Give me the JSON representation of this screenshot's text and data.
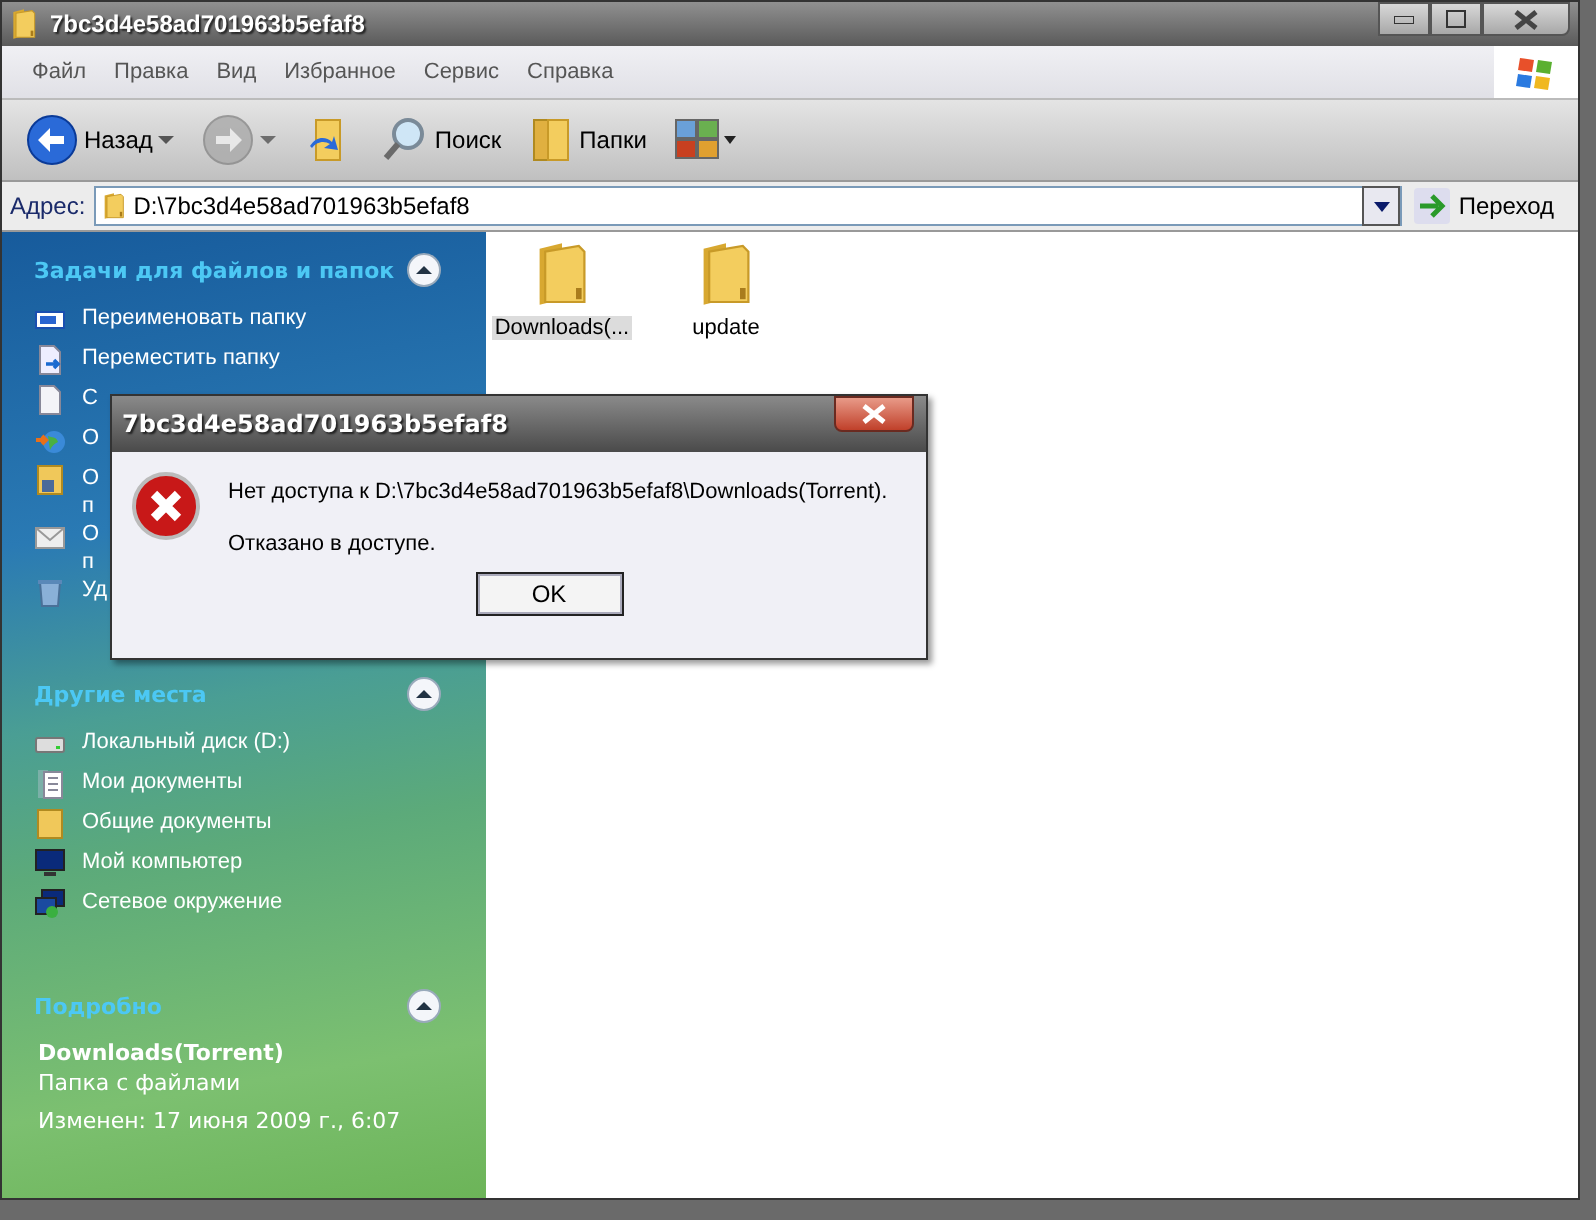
{
  "window": {
    "title": "7bc3d4e58ad701963b5efaf8"
  },
  "menu": [
    "Файл",
    "Правка",
    "Вид",
    "Избранное",
    "Сервис",
    "Справка"
  ],
  "toolbar": [
    {
      "kind": "back",
      "label": "Назад",
      "disabled": false
    },
    {
      "kind": "forward",
      "disabled": true
    },
    {
      "kind": "up",
      "disabled": false
    },
    {
      "kind": "search",
      "label": "Поиск",
      "disabled": false
    },
    {
      "kind": "folders",
      "label": "Папки",
      "disabled": false
    },
    {
      "kind": "views",
      "disabled": false
    }
  ],
  "address": {
    "label": "Адрес:",
    "value": "D:\\7bc3d4e58ad701963b5efaf8",
    "go": "Переход"
  },
  "sidebar": {
    "panels": [
      {
        "kind": "tasks",
        "title": "Задачи для файлов и папок",
        "expanded": true,
        "items": [
          {
            "kind": "rename",
            "lines": [
              "Переименовать папку"
            ]
          },
          {
            "kind": "move",
            "lines": [
              "Переместить папку"
            ]
          },
          {
            "kind": "copy",
            "lines": [
              "С"
            ]
          },
          {
            "kind": "publish",
            "lines": [
              "О"
            ]
          },
          {
            "kind": "share",
            "lines": [
              "О",
              "п"
            ]
          },
          {
            "kind": "email",
            "lines": [
              "О",
              "п"
            ]
          },
          {
            "kind": "delete",
            "lines": [
              "Уд"
            ]
          }
        ]
      },
      {
        "kind": "places",
        "title": "Другие места",
        "expanded": true,
        "items": [
          {
            "kind": "drive",
            "lines": [
              "Локальный диск (D:)"
            ]
          },
          {
            "kind": "documents",
            "lines": [
              "Мои документы"
            ]
          },
          {
            "kind": "folder",
            "lines": [
              "Общие документы"
            ]
          },
          {
            "kind": "computer",
            "lines": [
              "Мой компьютер"
            ]
          },
          {
            "kind": "network",
            "lines": [
              "Сетевое окружение"
            ]
          }
        ]
      },
      {
        "kind": "details",
        "title": "Подробно",
        "expanded": true,
        "name": "Downloads(Torrent)",
        "type": "Папка с файлами",
        "modified": "Изменен: 17 июня 2009 г., 6:07"
      }
    ]
  },
  "files": [
    {
      "name": "Downloads(...",
      "selected": true
    },
    {
      "name": "update",
      "selected": false
    }
  ],
  "dialog": {
    "title": "7bc3d4e58ad701963b5efaf8",
    "message": "Нет доступа к D:\\7bc3d4e58ad701963b5efaf8\\Downloads(Torrent).",
    "detail": "Отказано в доступе.",
    "button": "OK"
  }
}
